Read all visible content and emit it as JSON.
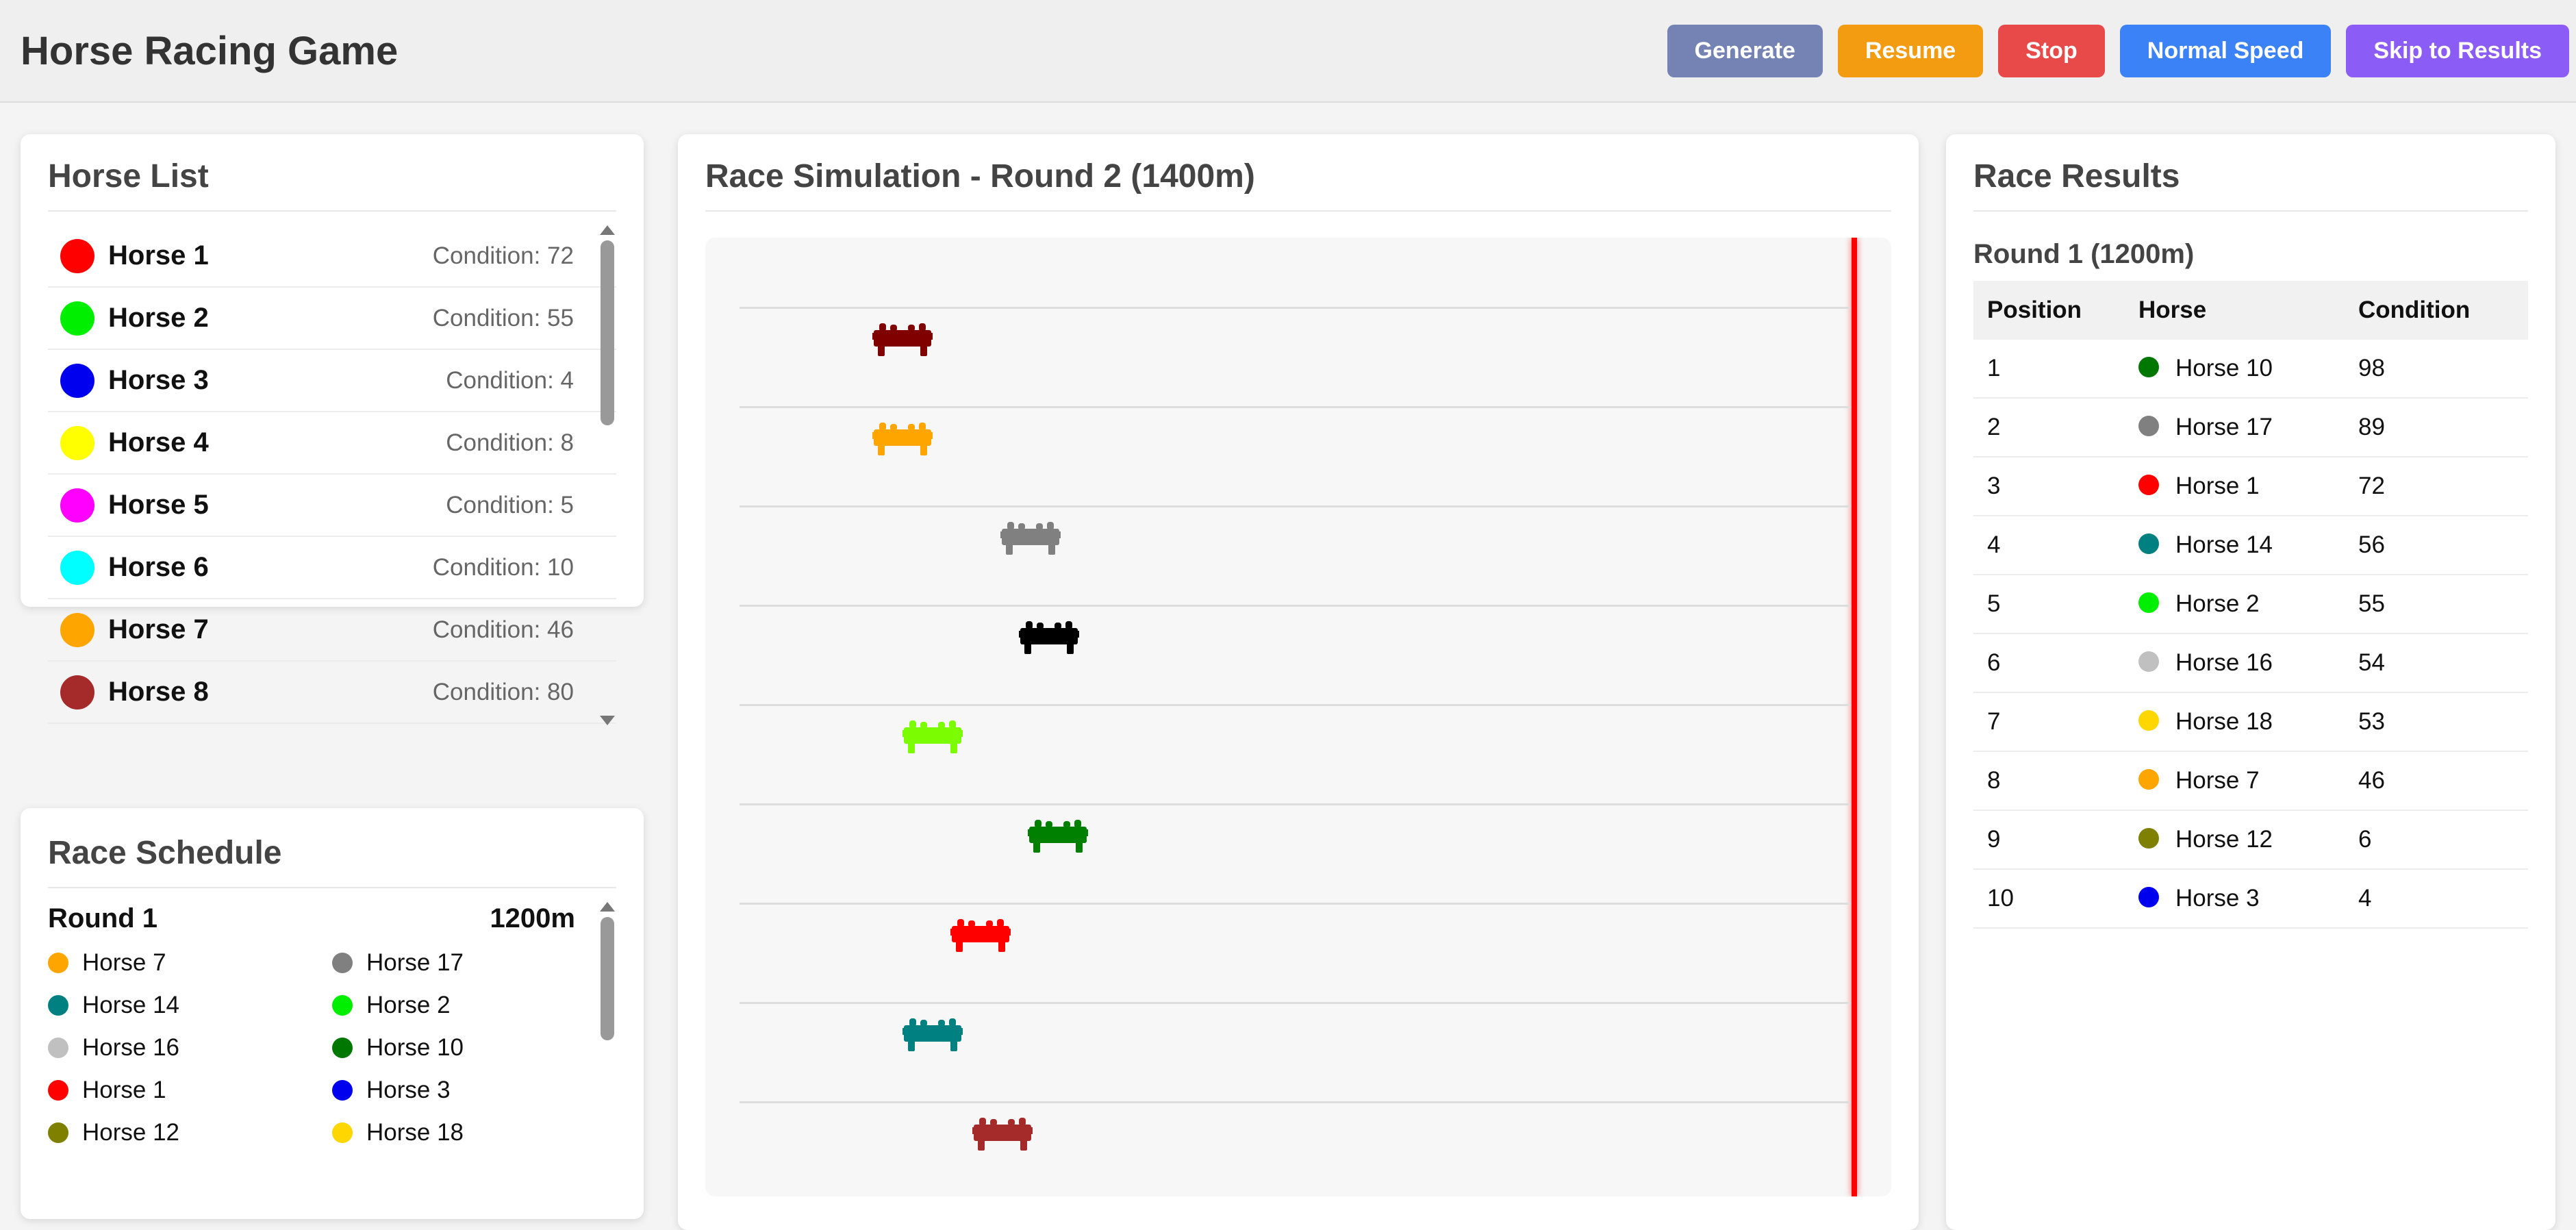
{
  "app": {
    "title": "Horse Racing Game"
  },
  "toolbar": {
    "buttons": [
      {
        "label": "Generate",
        "color": "#7483b3"
      },
      {
        "label": "Resume",
        "color": "#f39c12"
      },
      {
        "label": "Stop",
        "color": "#e84a4a"
      },
      {
        "label": "Normal Speed",
        "color": "#3b82f6"
      },
      {
        "label": "Skip to Results",
        "color": "#8b5cf6"
      }
    ]
  },
  "horse_list": {
    "title": "Horse List",
    "horses": [
      {
        "name": "Horse 1",
        "condition_label": "Condition: 72",
        "color": "#ff0000"
      },
      {
        "name": "Horse 2",
        "condition_label": "Condition: 55",
        "color": "#00ee00"
      },
      {
        "name": "Horse 3",
        "condition_label": "Condition: 4",
        "color": "#0000ee"
      },
      {
        "name": "Horse 4",
        "condition_label": "Condition: 8",
        "color": "#ffff00"
      },
      {
        "name": "Horse 5",
        "condition_label": "Condition: 5",
        "color": "#ff00ff"
      },
      {
        "name": "Horse 6",
        "condition_label": "Condition: 10",
        "color": "#00ffff"
      },
      {
        "name": "Horse 7",
        "condition_label": "Condition: 46",
        "color": "#ffa500"
      },
      {
        "name": "Horse 8",
        "condition_label": "Condition: 80",
        "color": "#a52a2a"
      }
    ]
  },
  "schedule": {
    "title": "Race Schedule",
    "round_label": "Round 1",
    "distance": "1200m",
    "entries": [
      {
        "name": "Horse 7",
        "color": "#ffa500"
      },
      {
        "name": "Horse 17",
        "color": "#808080"
      },
      {
        "name": "Horse 14",
        "color": "#008080"
      },
      {
        "name": "Horse 2",
        "color": "#00ee00"
      },
      {
        "name": "Horse 16",
        "color": "#c0c0c0"
      },
      {
        "name": "Horse 10",
        "color": "#007700"
      },
      {
        "name": "Horse 1",
        "color": "#ff0000"
      },
      {
        "name": "Horse 3",
        "color": "#0000ee"
      },
      {
        "name": "Horse 12",
        "color": "#808000"
      },
      {
        "name": "Horse 18",
        "color": "#ffd700"
      }
    ]
  },
  "simulation": {
    "title": "Race Simulation - Round 2 (1400m)",
    "runners": [
      {
        "color": "#800000",
        "progress": 0.12
      },
      {
        "color": "#ffa500",
        "progress": 0.12
      },
      {
        "color": "#808080",
        "progress": 0.235
      },
      {
        "color": "#000000",
        "progress": 0.252
      },
      {
        "color": "#7cfc00",
        "progress": 0.147
      },
      {
        "color": "#008000",
        "progress": 0.26
      },
      {
        "color": "#ff0000",
        "progress": 0.19
      },
      {
        "color": "#008080",
        "progress": 0.147
      },
      {
        "color": "#a52a2a",
        "progress": 0.21
      }
    ]
  },
  "results": {
    "title": "Race Results",
    "round_title": "Round 1 (1200m)",
    "columns": [
      "Position",
      "Horse",
      "Condition"
    ],
    "rows": [
      {
        "position": "1",
        "horse": "Horse 10",
        "condition": "98",
        "color": "#007700"
      },
      {
        "position": "2",
        "horse": "Horse 17",
        "condition": "89",
        "color": "#808080"
      },
      {
        "position": "3",
        "horse": "Horse 1",
        "condition": "72",
        "color": "#ff0000"
      },
      {
        "position": "4",
        "horse": "Horse 14",
        "condition": "56",
        "color": "#008080"
      },
      {
        "position": "5",
        "horse": "Horse 2",
        "condition": "55",
        "color": "#00ee00"
      },
      {
        "position": "6",
        "horse": "Horse 16",
        "condition": "54",
        "color": "#c0c0c0"
      },
      {
        "position": "7",
        "horse": "Horse 18",
        "condition": "53",
        "color": "#ffd700"
      },
      {
        "position": "8",
        "horse": "Horse 7",
        "condition": "46",
        "color": "#ffa500"
      },
      {
        "position": "9",
        "horse": "Horse 12",
        "condition": "6",
        "color": "#808000"
      },
      {
        "position": "10",
        "horse": "Horse 3",
        "condition": "4",
        "color": "#0000ee"
      }
    ]
  }
}
